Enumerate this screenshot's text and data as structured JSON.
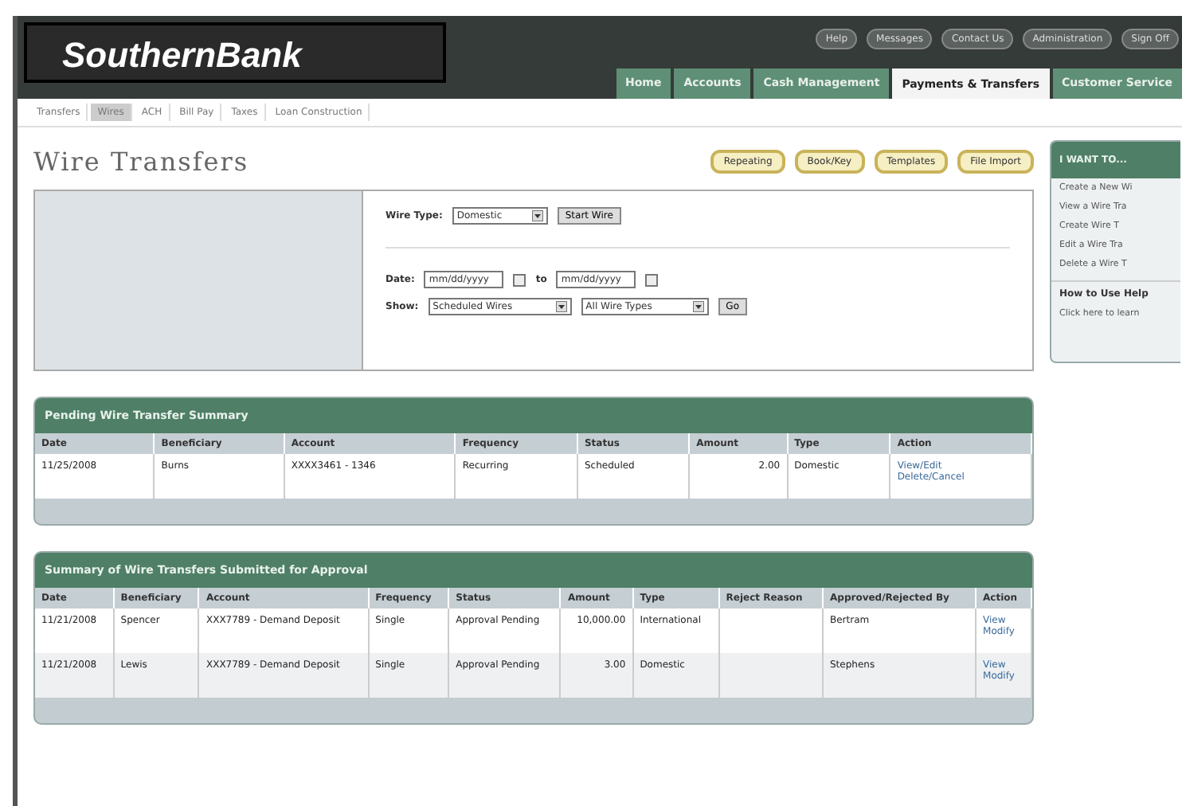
{
  "logo": "SouthernBank",
  "top_links": [
    "Help",
    "Messages",
    "Contact Us",
    "Administration",
    "Sign Off"
  ],
  "main_tabs": [
    {
      "label": "Home",
      "selected": false
    },
    {
      "label": "Accounts",
      "selected": false
    },
    {
      "label": "Cash Management",
      "selected": false
    },
    {
      "label": "Payments & Transfers",
      "selected": true
    },
    {
      "label": "Customer Service",
      "selected": false
    }
  ],
  "sub_tabs": [
    {
      "label": "Transfers",
      "selected": false
    },
    {
      "label": "Wires",
      "selected": true
    },
    {
      "label": "ACH",
      "selected": false
    },
    {
      "label": "Bill Pay",
      "selected": false
    },
    {
      "label": "Taxes",
      "selected": false
    },
    {
      "label": "Loan Construction",
      "selected": false
    }
  ],
  "page_title": "Wire Transfers",
  "actions": [
    "Repeating",
    "Book/Key",
    "Templates",
    "File Import"
  ],
  "form": {
    "wire_type_label": "Wire Type:",
    "wire_type": "Domestic",
    "start_button": "Start Wire",
    "date_label": "Date:",
    "date_from": "mm/dd/yyyy",
    "to_label": "to",
    "date_to": "mm/dd/yyyy",
    "show_label": "Show:",
    "show": "Scheduled Wires",
    "types": "All Wire Types",
    "go_button": "Go"
  },
  "pending": {
    "title": "Pending Wire Transfer Summary",
    "columns": [
      "Date",
      "Beneficiary",
      "Account",
      "Frequency",
      "Status",
      "Amount",
      "Type",
      "Action"
    ],
    "rows": [
      {
        "cells": [
          "11/25/2008",
          "Burns",
          "XXXX3461 - 1346",
          "Recurring",
          "Scheduled",
          "2.00",
          "Domestic"
        ],
        "actions": [
          "View/Edit",
          "Delete/Cancel"
        ]
      }
    ]
  },
  "approval": {
    "title": "Summary of Wire Transfers Submitted for Approval",
    "columns": [
      "Date",
      "Beneficiary",
      "Account",
      "Frequency",
      "Status",
      "Amount",
      "Type",
      "Reject Reason",
      "Approved/Rejected By",
      "Action"
    ],
    "rows": [
      {
        "cells": [
          "11/21/2008",
          "Spencer",
          "XXX7789 - Demand Deposit",
          "Single",
          "Approval Pending",
          "10,000.00",
          "International",
          "",
          "Bertram"
        ],
        "actions": [
          "View",
          "Modify"
        ]
      },
      {
        "cells": [
          "11/21/2008",
          "Lewis",
          "XXX7789 - Demand Deposit",
          "Single",
          "Approval Pending",
          "3.00",
          "Domestic",
          "",
          "Stephens"
        ],
        "actions": [
          "View",
          "Modify"
        ]
      }
    ]
  },
  "sidebar": {
    "title": "I WANT TO...",
    "items": [
      "Create a New Wi",
      "View a Wire Tra",
      "Create Wire T",
      "Edit a Wire Tra",
      "Delete a Wire T"
    ],
    "help_title": "How to Use Help",
    "help_text": "Click here to learn"
  }
}
